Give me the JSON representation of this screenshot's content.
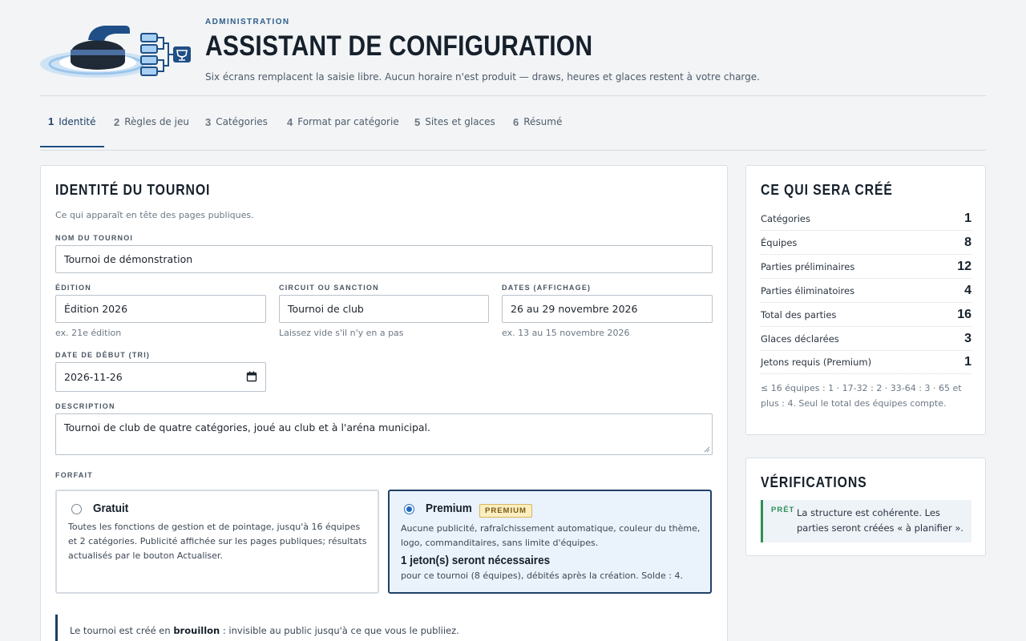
{
  "header": {
    "eyebrow": "ADMINISTRATION",
    "title": "ASSISTANT DE CONFIGURATION",
    "subtitle": "Six écrans remplacent la saisie libre. Aucun horaire n'est produit — draws, heures et glaces restent à votre charge."
  },
  "tabs": [
    {
      "num": "1",
      "label": "Identité",
      "active": true
    },
    {
      "num": "2",
      "label": "Règles de jeu"
    },
    {
      "num": "3",
      "label": "Catégories"
    },
    {
      "num": "4",
      "label": "Format par catégorie"
    },
    {
      "num": "5",
      "label": "Sites et glaces"
    },
    {
      "num": "6",
      "label": "Résumé"
    }
  ],
  "identity": {
    "title": "IDENTITÉ DU TOURNOI",
    "intro": "Ce qui apparaît en tête des pages publiques.",
    "name_label": "NOM DU TOURNOI",
    "name_value": "Tournoi de démonstration",
    "edition_label": "ÉDITION",
    "edition_value": "Édition 2026",
    "edition_hint": "ex. 21e édition",
    "circuit_label": "CIRCUIT OU SANCTION",
    "circuit_value": "Tournoi de club",
    "circuit_hint": "Laissez vide s'il n'y en a pas",
    "dates_label": "DATES (AFFICHAGE)",
    "dates_value": "26 au 29 novembre 2026",
    "dates_hint": "ex. 13 au 15 novembre 2026",
    "start_label": "DATE DE DÉBUT (TRI)",
    "start_value": "2026-11-26",
    "desc_label": "DESCRIPTION",
    "desc_value": "Tournoi de club de quatre catégories, joué au club et à l'aréna municipal.",
    "plan_label": "FORFAIT",
    "free": {
      "name": "Gratuit",
      "desc": "Toutes les fonctions de gestion et de pointage, jusqu'à 16 équipes et 2 catégories. Publicité affichée sur les pages publiques; résultats actualisés par le bouton Actualiser."
    },
    "premium": {
      "name": "Premium",
      "badge": "PREMIUM",
      "desc": "Aucune publicité, rafraîchissement automatique, couleur du thème, logo, commanditaires, sans limite d'équipes.",
      "tokens": "1 jeton(s) seront nécessaires",
      "tokens_sub": "pour ce tournoi (8 équipes), débités après la création. Solde : 4."
    },
    "notice_pre": "Le tournoi est créé en ",
    "notice_bold": "brouillon",
    "notice_post": " : invisible au public jusqu'à ce que vous le publiiez."
  },
  "summary": {
    "title": "CE QUI SERA CRÉÉ",
    "rows": [
      {
        "label": "Catégories",
        "value": "1"
      },
      {
        "label": "Équipes",
        "value": "8"
      },
      {
        "label": "Parties préliminaires",
        "value": "12"
      },
      {
        "label": "Parties éliminatoires",
        "value": "4"
      },
      {
        "label": "Total des parties",
        "value": "16"
      },
      {
        "label": "Glaces déclarées",
        "value": "3"
      },
      {
        "label": "Jetons requis (Premium)",
        "value": "1"
      }
    ],
    "note": "≤ 16 équipes : 1 · 17-32 : 2 · 33-64 : 3 · 65 et plus : 4. Seul le total des équipes compte."
  },
  "checks": {
    "title": "VÉRIFICATIONS",
    "tag": "PRÊT",
    "message": "La structure est cohérente. Les parties seront créées « à planifier »."
  },
  "colors": {
    "accent": "#1c3f66",
    "ok": "#2f8f57",
    "premium_bg": "#eaf2fb",
    "badge_bg": "#fbeec1"
  }
}
